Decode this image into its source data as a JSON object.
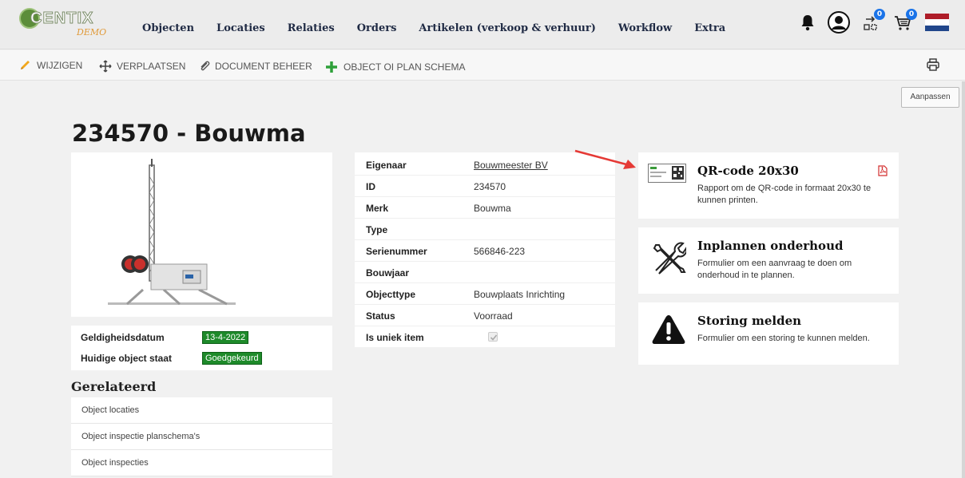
{
  "logo": {
    "text": "CENTIX",
    "sub": "DEMO"
  },
  "menu": [
    {
      "label": "Objecten"
    },
    {
      "label": "Locaties"
    },
    {
      "label": "Relaties"
    },
    {
      "label": "Orders"
    },
    {
      "label": "Artikelen (verkoop & verhuur)"
    },
    {
      "label": "Workflow"
    },
    {
      "label": "Extra"
    }
  ],
  "nav_badges": {
    "tasks": "0",
    "cart": "0"
  },
  "toolbar": {
    "edit": "WIJZIGEN",
    "move": "VERPLAATSEN",
    "docs": "DOCUMENT BEHEER",
    "schema": "OBJECT OI PLAN SCHEMA"
  },
  "aanpassen_label": "Aanpassen",
  "page_title": "234570 - Bouwma",
  "validity": [
    {
      "label": "Geldigheidsdatum",
      "value": "13-4-2022"
    },
    {
      "label": "Huidige object staat",
      "value": "Goedgekeurd"
    }
  ],
  "related": {
    "title": "Gerelateerd",
    "items": [
      {
        "label": "Object locaties"
      },
      {
        "label": "Object inspectie planschema's"
      },
      {
        "label": "Object inspecties"
      }
    ]
  },
  "details": [
    {
      "label": "Eigenaar",
      "value": "Bouwmeester BV"
    },
    {
      "label": "ID",
      "value": "234570"
    },
    {
      "label": "Merk",
      "value": "Bouwma"
    },
    {
      "label": "Type",
      "value": ""
    },
    {
      "label": "Serienummer",
      "value": "566846-223"
    },
    {
      "label": "Bouwjaar",
      "value": ""
    },
    {
      "label": "Objecttype",
      "value": "Bouwplaats Inrichting"
    },
    {
      "label": "Status",
      "value": "Voorraad"
    },
    {
      "label": "Is uniek item",
      "value": ""
    }
  ],
  "cards": [
    {
      "title": "QR-code 20x30",
      "desc": "Rapport om de QR-code in formaat 20x30 te kunnen printen."
    },
    {
      "title": "Inplannen onderhoud",
      "desc": "Formulier om een aanvraag te doen om onderhoud in te plannen."
    },
    {
      "title": "Storing melden",
      "desc": "Formulier om een storing te kunnen melden."
    }
  ],
  "colors": {
    "accent_green": "#1e8a2a",
    "arrow_red": "#e53935",
    "pdf_red": "#d32f2f",
    "navy": "#1f2a44"
  }
}
